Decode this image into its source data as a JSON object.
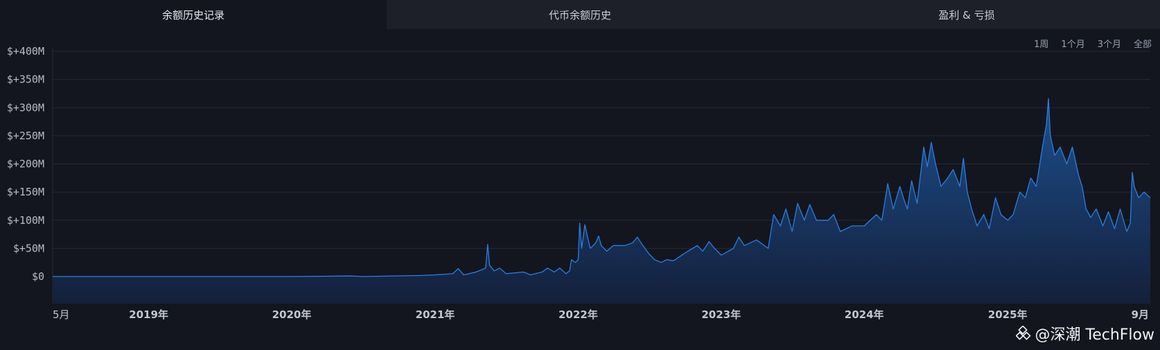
{
  "tabs": [
    {
      "label": "余额历史记录",
      "active": true
    },
    {
      "label": "代币余额历史",
      "active": false
    },
    {
      "label": "盈利 & 亏损",
      "active": false
    }
  ],
  "ranges": [
    "1周",
    "1个月",
    "3个月",
    "全部"
  ],
  "watermark": {
    "text": "@深潮 TechFlow"
  },
  "colors": {
    "line": "#2b7fe0",
    "area_top": "#1c4f8f",
    "area_bottom": "#14203a",
    "grid": "#252936",
    "background": "#13161f"
  },
  "chart_data": {
    "type": "area",
    "title": "",
    "xlabel": "",
    "ylabel": "",
    "y_unit": "M USD",
    "ylim": [
      -48,
      400
    ],
    "yticks": [
      0,
      50,
      100,
      150,
      200,
      250,
      300,
      350,
      400
    ],
    "ytick_labels": [
      "$0",
      "$+50M",
      "$+100M",
      "$+150M",
      "$+200M",
      "$+250M",
      "$+300M",
      "$+350M",
      "$+400M"
    ],
    "xlim": [
      "2018-05-01",
      "2025-12-31"
    ],
    "xticks": [
      {
        "date": "2018-05-01",
        "label": "5月"
      },
      {
        "date": "2019-01-01",
        "label": "2019年"
      },
      {
        "date": "2020-01-01",
        "label": "2020年"
      },
      {
        "date": "2021-01-01",
        "label": "2021年"
      },
      {
        "date": "2022-01-01",
        "label": "2022年"
      },
      {
        "date": "2023-01-01",
        "label": "2023年"
      },
      {
        "date": "2024-01-01",
        "label": "2024年"
      },
      {
        "date": "2025-01-01",
        "label": "2025年"
      },
      {
        "date": "2025-12-01",
        "label": "9月"
      }
    ],
    "grid": true,
    "legend": "none",
    "series": [
      {
        "points": [
          [
            "2018-05-01",
            0
          ],
          [
            "2019-01-01",
            0
          ],
          [
            "2020-01-01",
            0
          ],
          [
            "2020-06-01",
            1
          ],
          [
            "2020-07-01",
            0
          ],
          [
            "2020-12-01",
            2
          ],
          [
            "2021-01-01",
            3
          ],
          [
            "2021-02-15",
            5
          ],
          [
            "2021-03-01",
            14
          ],
          [
            "2021-03-15",
            3
          ],
          [
            "2021-04-15",
            8
          ],
          [
            "2021-05-10",
            15
          ],
          [
            "2021-05-15",
            57
          ],
          [
            "2021-05-20",
            20
          ],
          [
            "2021-06-01",
            10
          ],
          [
            "2021-06-15",
            15
          ],
          [
            "2021-07-01",
            5
          ],
          [
            "2021-08-15",
            8
          ],
          [
            "2021-09-01",
            3
          ],
          [
            "2021-10-01",
            8
          ],
          [
            "2021-10-15",
            15
          ],
          [
            "2021-11-01",
            8
          ],
          [
            "2021-11-15",
            15
          ],
          [
            "2021-12-01",
            5
          ],
          [
            "2021-12-10",
            10
          ],
          [
            "2021-12-15",
            30
          ],
          [
            "2021-12-25",
            25
          ],
          [
            "2022-01-01",
            30
          ],
          [
            "2022-01-05",
            95
          ],
          [
            "2022-01-10",
            50
          ],
          [
            "2022-01-18",
            92
          ],
          [
            "2022-01-25",
            70
          ],
          [
            "2022-02-01",
            50
          ],
          [
            "2022-02-15",
            60
          ],
          [
            "2022-02-22",
            72
          ],
          [
            "2022-03-01",
            55
          ],
          [
            "2022-03-15",
            45
          ],
          [
            "2022-04-01",
            55
          ],
          [
            "2022-05-01",
            55
          ],
          [
            "2022-05-20",
            60
          ],
          [
            "2022-06-01",
            70
          ],
          [
            "2022-06-15",
            55
          ],
          [
            "2022-07-01",
            40
          ],
          [
            "2022-07-15",
            30
          ],
          [
            "2022-08-01",
            25
          ],
          [
            "2022-08-15",
            30
          ],
          [
            "2022-09-01",
            28
          ],
          [
            "2022-10-01",
            42
          ],
          [
            "2022-11-01",
            55
          ],
          [
            "2022-11-15",
            45
          ],
          [
            "2022-12-01",
            62
          ],
          [
            "2022-12-15",
            50
          ],
          [
            "2023-01-01",
            38
          ],
          [
            "2023-02-01",
            50
          ],
          [
            "2023-02-15",
            70
          ],
          [
            "2023-03-01",
            55
          ],
          [
            "2023-04-01",
            65
          ],
          [
            "2023-05-01",
            50
          ],
          [
            "2023-05-15",
            110
          ],
          [
            "2023-06-01",
            90
          ],
          [
            "2023-06-15",
            120
          ],
          [
            "2023-07-01",
            80
          ],
          [
            "2023-07-15",
            130
          ],
          [
            "2023-08-01",
            100
          ],
          [
            "2023-08-15",
            128
          ],
          [
            "2023-09-01",
            100
          ],
          [
            "2023-10-01",
            100
          ],
          [
            "2023-10-15",
            110
          ],
          [
            "2023-11-01",
            80
          ],
          [
            "2023-12-01",
            90
          ],
          [
            "2024-01-01",
            90
          ],
          [
            "2024-02-01",
            110
          ],
          [
            "2024-02-15",
            100
          ],
          [
            "2024-03-01",
            165
          ],
          [
            "2024-03-15",
            120
          ],
          [
            "2024-04-01",
            160
          ],
          [
            "2024-04-10",
            140
          ],
          [
            "2024-04-20",
            120
          ],
          [
            "2024-05-01",
            170
          ],
          [
            "2024-05-15",
            130
          ],
          [
            "2024-06-01",
            230
          ],
          [
            "2024-06-10",
            195
          ],
          [
            "2024-06-20",
            238
          ],
          [
            "2024-07-01",
            200
          ],
          [
            "2024-07-15",
            160
          ],
          [
            "2024-08-01",
            175
          ],
          [
            "2024-08-15",
            190
          ],
          [
            "2024-09-01",
            160
          ],
          [
            "2024-09-10",
            210
          ],
          [
            "2024-09-20",
            150
          ],
          [
            "2024-10-01",
            120
          ],
          [
            "2024-10-15",
            90
          ],
          [
            "2024-11-01",
            110
          ],
          [
            "2024-11-15",
            85
          ],
          [
            "2024-12-01",
            140
          ],
          [
            "2024-12-15",
            110
          ],
          [
            "2025-01-01",
            100
          ],
          [
            "2025-01-15",
            110
          ],
          [
            "2025-02-01",
            150
          ],
          [
            "2025-02-15",
            140
          ],
          [
            "2025-03-01",
            175
          ],
          [
            "2025-03-15",
            160
          ],
          [
            "2025-04-01",
            235
          ],
          [
            "2025-04-10",
            270
          ],
          [
            "2025-04-15",
            316
          ],
          [
            "2025-04-20",
            250
          ],
          [
            "2025-05-01",
            215
          ],
          [
            "2025-05-15",
            230
          ],
          [
            "2025-06-01",
            200
          ],
          [
            "2025-06-15",
            230
          ],
          [
            "2025-07-01",
            180
          ],
          [
            "2025-07-10",
            160
          ],
          [
            "2025-07-20",
            120
          ],
          [
            "2025-08-01",
            105
          ],
          [
            "2025-08-15",
            120
          ],
          [
            "2025-09-01",
            90
          ],
          [
            "2025-09-15",
            115
          ],
          [
            "2025-10-01",
            85
          ],
          [
            "2025-10-15",
            120
          ],
          [
            "2025-11-01",
            80
          ],
          [
            "2025-11-10",
            95
          ],
          [
            "2025-11-15",
            185
          ],
          [
            "2025-11-20",
            160
          ],
          [
            "2025-12-01",
            140
          ],
          [
            "2025-12-15",
            150
          ],
          [
            "2025-12-31",
            140
          ]
        ]
      }
    ]
  }
}
